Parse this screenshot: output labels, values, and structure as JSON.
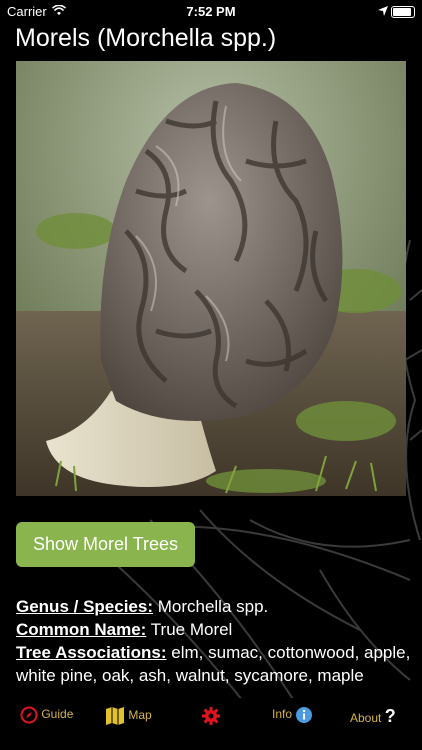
{
  "status_bar": {
    "carrier": "Carrier",
    "time": "7:52 PM"
  },
  "page_title": "Morels (Morchella spp.)",
  "photo": {
    "alt": "Morel mushroom"
  },
  "show_trees_button": "Show Morel Trees",
  "details": {
    "genus_label": "Genus / Species:",
    "genus_value": " Morchella spp.",
    "common_label": "Common Name:",
    "common_value": " True Morel",
    "tree_label": "Tree Associations:",
    "tree_value": " elm, sumac, cottonwood, apple, white pine, oak, ash, walnut, sycamore, maple"
  },
  "tabs": [
    {
      "label": "Guide",
      "icon": "compass-icon"
    },
    {
      "label": "Map",
      "icon": "map-icon"
    },
    {
      "label": "",
      "icon": "gear-icon"
    },
    {
      "label": "Info",
      "icon": "info-icon"
    },
    {
      "label": "About",
      "icon": "question-icon"
    }
  ],
  "colors": {
    "accent": "#8ab44d",
    "tab_text": "#d4b24a",
    "gear": "#e0141e"
  }
}
